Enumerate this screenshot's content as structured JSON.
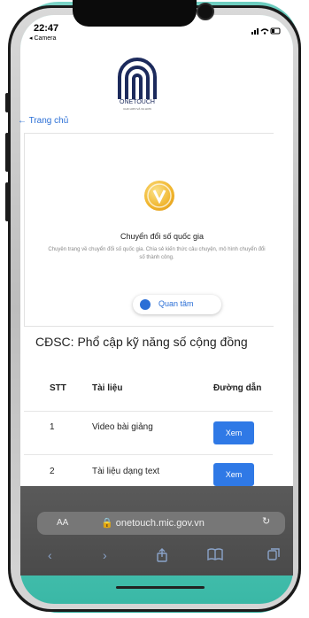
{
  "status_bar": {
    "time": "22:47",
    "back_app": "◂ Camera",
    "signal": "▪▪▮ ᯤ ▭"
  },
  "logo": {
    "text": "ONETOUCH",
    "sub": "CHO HƠN VÀ XA HƠN"
  },
  "nav": {
    "home_link": "← Trang chủ"
  },
  "card": {
    "title": "Chuyển đổi số quốc gia",
    "description": "Chuyên trang về chuyển đổi số quốc gia. Chia sẻ kiến thức câu chuyện, mô hình chuyển đổi số thành công.",
    "button_label": "Quan tâm"
  },
  "section": {
    "heading": "CĐSC: Phổ cập kỹ năng số cộng đồng"
  },
  "table": {
    "headers": [
      "STT",
      "Tài liệu",
      "Đường dẫn"
    ],
    "rows": [
      {
        "stt": "1",
        "doc": "Video bài giảng",
        "link": "Xem"
      },
      {
        "stt": "2",
        "doc": "Tài liệu dạng text",
        "link": "Xem"
      }
    ]
  },
  "browser": {
    "aa": "AA",
    "url": "🔒 onetouch.mic.gov.vn",
    "reload": "↻"
  },
  "toolbar_icons": [
    "back-icon",
    "forward-icon",
    "share-icon",
    "bookmarks-icon",
    "tabs-icon"
  ],
  "colors": {
    "accent": "#2f79e6",
    "frame": "#45b9aa",
    "link": "#2b6fd6"
  }
}
